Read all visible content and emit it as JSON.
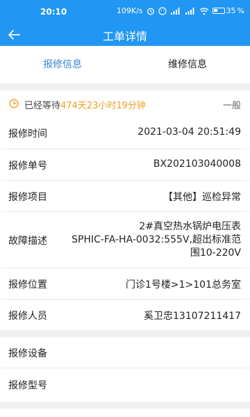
{
  "status": {
    "time": "20:10",
    "speed": "109K/s",
    "battery": "35"
  },
  "appbar": {
    "title": "工单详情"
  },
  "tabs": [
    {
      "label": "报修信息",
      "active": true
    },
    {
      "label": "维修信息",
      "active": false
    }
  ],
  "wait": {
    "prefix": "已经等待",
    "duration": "474天23小时19分钟",
    "level": "一般"
  },
  "rows": [
    {
      "label": "报修时间",
      "value": "2021-03-04 20:51:49"
    },
    {
      "label": "报修单号",
      "value": "BX202103040008"
    },
    {
      "label": "报修项目",
      "value": "【其他】巡检异常"
    },
    {
      "label": "故障描述",
      "value_lines": [
        "2#真空热水锅炉电压表",
        "SPHIC-FA-HA-0032:555V,超出标准范",
        "围10-220V"
      ]
    },
    {
      "label": "报修位置",
      "value": "门诊1号楼>1>101总务室"
    },
    {
      "label": "报修人员",
      "value": "奚卫忠13107211417"
    },
    {
      "label": "报修设备",
      "value": ""
    },
    {
      "label": "报修型号",
      "value": ""
    }
  ],
  "colors": {
    "primary": "#2196f3",
    "tab_active": "#3a86d6",
    "highlight": "#f0a020"
  }
}
